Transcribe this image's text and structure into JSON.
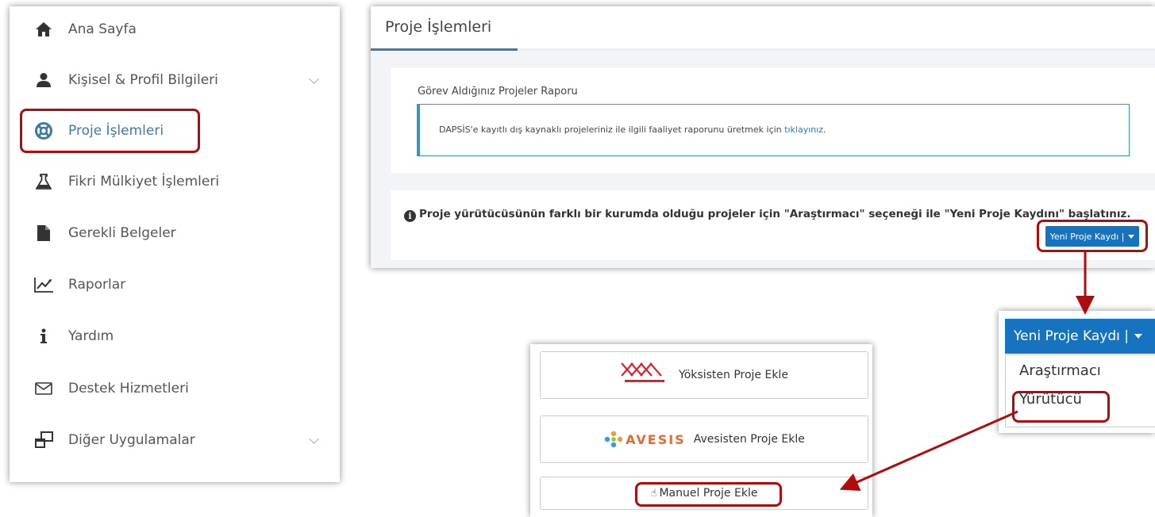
{
  "sidebar": {
    "items": [
      {
        "label": "Ana Sayfa",
        "icon": "home-icon"
      },
      {
        "label": "Kişisel & Profil Bilgileri",
        "icon": "user-icon",
        "expandable": true
      },
      {
        "label": "Proje İşlemleri",
        "icon": "lifebuoy-icon",
        "active": true
      },
      {
        "label": "Fikri Mülkiyet İşlemleri",
        "icon": "flask-icon"
      },
      {
        "label": "Gerekli Belgeler",
        "icon": "file-icon"
      },
      {
        "label": "Raporlar",
        "icon": "chart-line-icon"
      },
      {
        "label": "Yardım",
        "icon": "info-icon"
      },
      {
        "label": "Destek Hizmetleri",
        "icon": "envelope-icon"
      },
      {
        "label": "Diğer Uygulamalar",
        "icon": "windows-icon",
        "expandable": true
      }
    ]
  },
  "main": {
    "title": "Proje İşlemleri",
    "report_card": {
      "title": "Görev Aldığınız Projeler Raporu",
      "note_text": "DAPSİS'e kayıtlı dış kaynaklı projeleriniz ile ilgili faaliyet raporunu üretmek için ",
      "note_link": "tıklayınız",
      "note_end": "."
    },
    "info_text": "Proje yürütücüsünün farklı bir kurumda olduğu projeler için \"Araştırmacı\" seçeneği ile \"Yeni Proje Kaydını\" başlatınız.",
    "new_project_button": "Yeni Proje Kaydı |"
  },
  "dropdown": {
    "button_label": "Yeni Proje Kaydı |",
    "options": [
      "Araştırmacı",
      "Yürütücü"
    ]
  },
  "add_options": {
    "yoksis": "Yöksisten Proje Ekle",
    "avesis": "Avesisten Proje Ekle",
    "avesis_logo_text": "AVESIS",
    "manual": "Manuel Proje Ekle"
  },
  "colors": {
    "accent": "#1673c0",
    "highlight": "#b00c0c",
    "active_text": "#3d7aa9",
    "info_border": "#3d93b3"
  }
}
